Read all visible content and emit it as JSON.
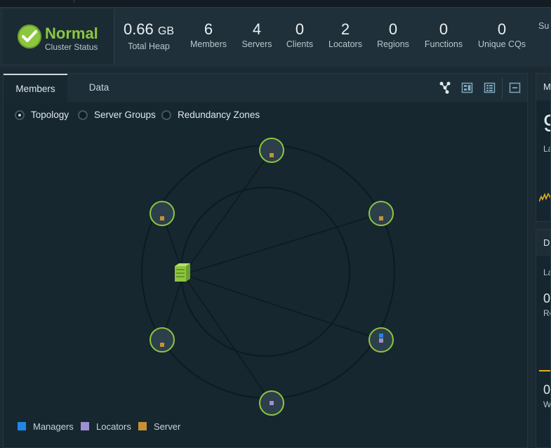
{
  "cluster_status": {
    "value": "Normal",
    "label": "Cluster Status"
  },
  "metrics": [
    {
      "value": "0.66",
      "unit": "GB",
      "label": "Total Heap"
    },
    {
      "value": "6",
      "label": "Members"
    },
    {
      "value": "4",
      "label": "Servers"
    },
    {
      "value": "0",
      "label": "Clients"
    },
    {
      "value": "2",
      "label": "Locators"
    },
    {
      "value": "0",
      "label": "Regions"
    },
    {
      "value": "0",
      "label": "Functions"
    },
    {
      "value": "0",
      "label": "Unique CQs"
    },
    {
      "value": "",
      "label": "Su"
    }
  ],
  "tabs": [
    {
      "label": "Members"
    },
    {
      "label": "Data"
    }
  ],
  "toolbar": {
    "icons": [
      "topology-view-icon",
      "grid-view-icon",
      "list-view-icon",
      "collapse-icon"
    ]
  },
  "view_options": [
    {
      "label": "Topology",
      "selected": true
    },
    {
      "label": "Server Groups",
      "selected": false
    },
    {
      "label": "Redundancy Zones",
      "selected": false
    }
  ],
  "legend": [
    {
      "label": "Managers",
      "color": "#1e88e5"
    },
    {
      "label": "Locators",
      "color": "#9f8fd0"
    },
    {
      "label": "Server",
      "color": "#c49235"
    }
  ],
  "colors": {
    "accent_green": "#8dc63f",
    "server": "#c49235",
    "locator": "#9f8fd0",
    "manager": "#1e88e5",
    "warning_yellow": "#e0b020"
  },
  "right_panels": {
    "top": {
      "header": "M",
      "big_value": "9",
      "label": "La"
    },
    "bottom": {
      "header": "D",
      "label1": "La",
      "value1": "0",
      "sub1": "Re",
      "value2": "0",
      "sub2": "W"
    }
  }
}
